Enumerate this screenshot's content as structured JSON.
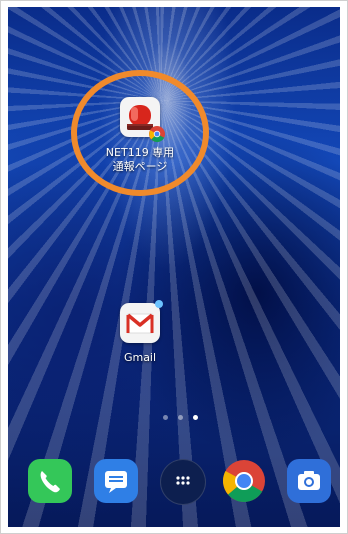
{
  "home": {
    "apps": [
      {
        "label_line1": "NET119 専用",
        "label_line2": "通報ページ",
        "icon": "emergency-siren-icon"
      },
      {
        "label_line1": "Gmail",
        "icon": "gmail-icon"
      }
    ],
    "page_indicator": {
      "pages": 3,
      "current": 3
    }
  },
  "dock": {
    "items": [
      {
        "name": "phone",
        "icon": "phone-icon"
      },
      {
        "name": "messages",
        "icon": "messages-icon"
      },
      {
        "name": "apps",
        "icon": "app-drawer-icon"
      },
      {
        "name": "chrome",
        "icon": "chrome-icon"
      },
      {
        "name": "camera",
        "icon": "camera-icon"
      }
    ]
  },
  "colors": {
    "highlight_ring": "#f08a2c",
    "phone_green": "#34c759",
    "messages_blue": "#2f7fe6",
    "camera_blue": "#2f6fd9"
  }
}
